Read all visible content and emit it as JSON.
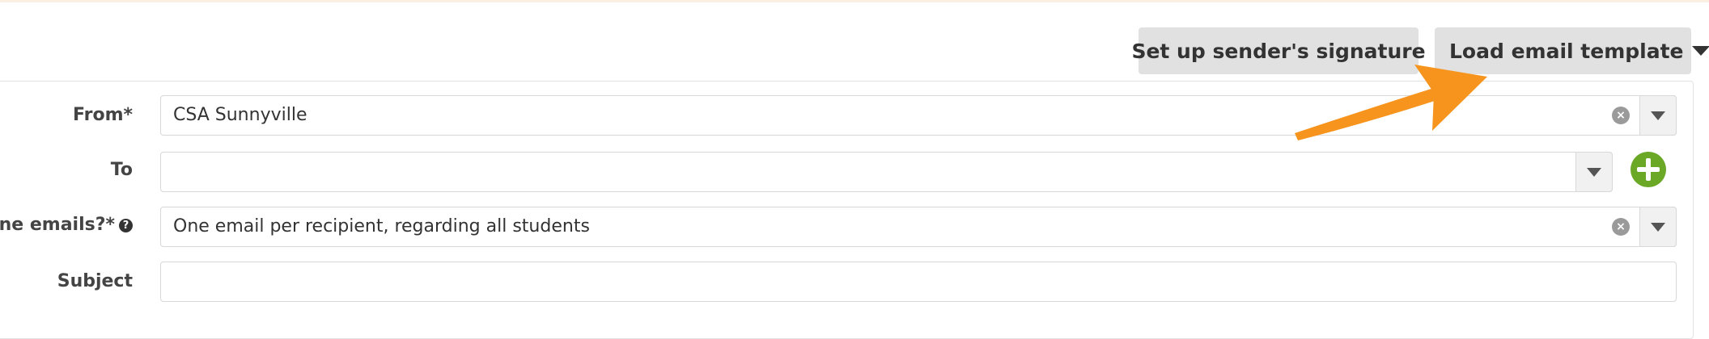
{
  "toolbar": {
    "signature_label": "Set up sender's signature",
    "template_label": "Load email template"
  },
  "form": {
    "from": {
      "label": "From*",
      "value": "CSA Sunnyville"
    },
    "to": {
      "label": "To",
      "value": ""
    },
    "combine": {
      "label": "mbine emails?*",
      "help": "?",
      "value": "One email per recipient, regarding all students"
    },
    "subject": {
      "label": "Subject",
      "value": ""
    }
  },
  "icons": {
    "clear": "clear-icon",
    "dropdown": "chevron-down-icon",
    "add": "plus-icon",
    "annotation": "arrow-pointer"
  },
  "colors": {
    "button_bg": "#e1e1e1",
    "add_green": "#6aa826",
    "annotation_orange": "#f7941d"
  }
}
